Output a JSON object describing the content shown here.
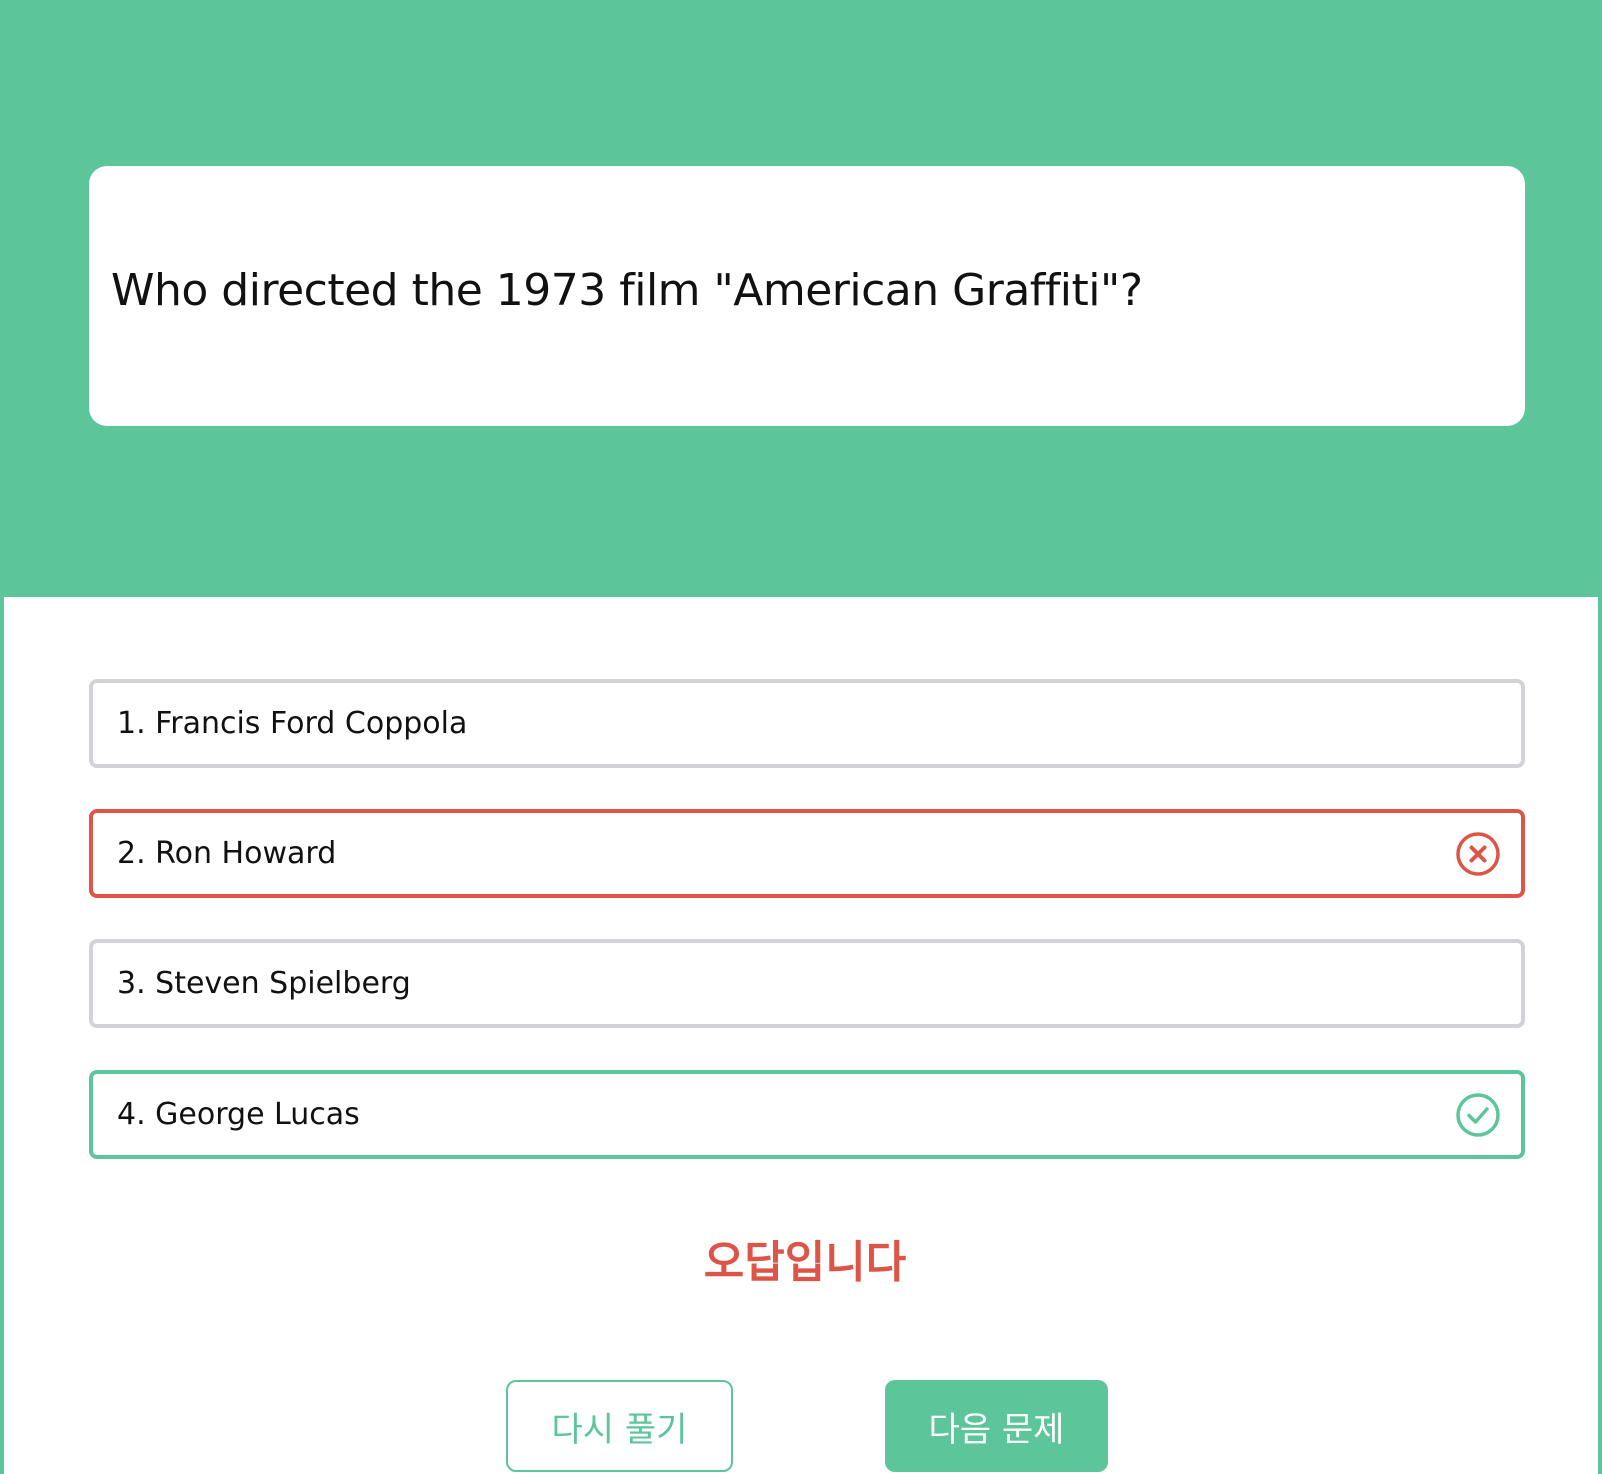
{
  "quiz": {
    "question": "Who directed the 1973 film \"American Graffiti\"?",
    "options": [
      {
        "label": "1. Francis Ford Coppola",
        "state": "neutral"
      },
      {
        "label": "2. Ron Howard",
        "state": "wrong"
      },
      {
        "label": "3. Steven Spielberg",
        "state": "neutral"
      },
      {
        "label": "4. George Lucas",
        "state": "correct"
      }
    ],
    "result_text": "오답입니다",
    "retry_label": "다시 풀기",
    "next_label": "다음 문제"
  },
  "icons": {
    "wrong": "close-circle-icon",
    "correct": "check-circle-icon"
  },
  "colors": {
    "brand": "#5cc69a",
    "wrong": "#dd5546",
    "neutral_border": "#d2d3d9",
    "text": "#111111"
  }
}
